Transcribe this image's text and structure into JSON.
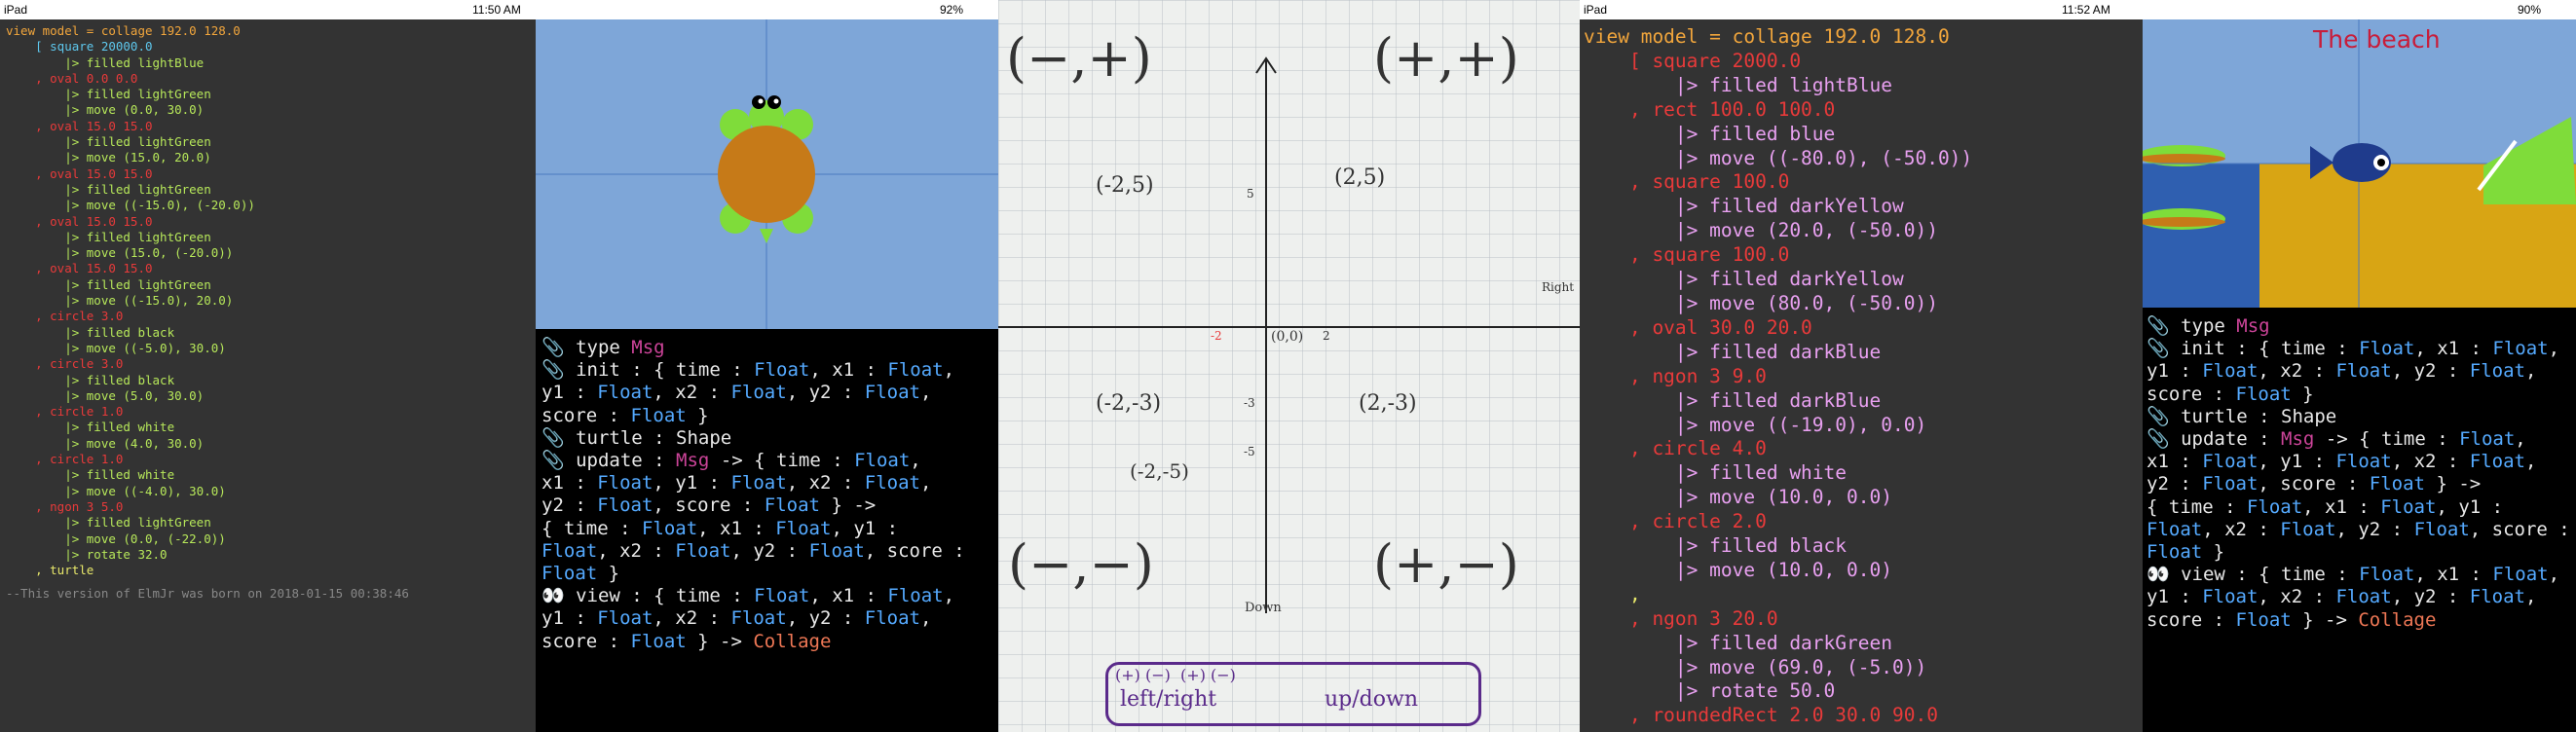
{
  "left_status": {
    "device": "iPad",
    "time": "11:50 AM",
    "battery": "92%"
  },
  "right_status": {
    "device": "iPad",
    "time": "11:52 AM",
    "battery": "90%"
  },
  "panel1": {
    "lines": [
      {
        "text": "view model = collage 192.0 128.0",
        "cls": "t-def"
      },
      {
        "text": "    [ square 20000.0",
        "cls": "t-num"
      },
      {
        "text": "        |> filled lightBlue",
        "cls": "t-fn"
      },
      {
        "text": "    , oval 0.0 0.0",
        "cls": "t-red"
      },
      {
        "text": "        |> filled lightGreen",
        "cls": "t-fn"
      },
      {
        "text": "        |> move (0.0, 30.0)",
        "cls": "t-fn"
      },
      {
        "text": "    , oval 15.0 15.0",
        "cls": "t-red"
      },
      {
        "text": "        |> filled lightGreen",
        "cls": "t-fn"
      },
      {
        "text": "        |> move (15.0, 20.0)",
        "cls": "t-fn"
      },
      {
        "text": "    , oval 15.0 15.0",
        "cls": "t-red"
      },
      {
        "text": "        |> filled lightGreen",
        "cls": "t-fn"
      },
      {
        "text": "        |> move ((-15.0), (-20.0))",
        "cls": "t-fn"
      },
      {
        "text": "    , oval 15.0 15.0",
        "cls": "t-red"
      },
      {
        "text": "        |> filled lightGreen",
        "cls": "t-fn"
      },
      {
        "text": "        |> move (15.0, (-20.0))",
        "cls": "t-fn"
      },
      {
        "text": "    , oval 15.0 15.0",
        "cls": "t-red"
      },
      {
        "text": "        |> filled lightGreen",
        "cls": "t-fn"
      },
      {
        "text": "        |> move ((-15.0), 20.0)",
        "cls": "t-fn"
      },
      {
        "text": "    , circle 3.0",
        "cls": "t-red"
      },
      {
        "text": "        |> filled black",
        "cls": "t-fn"
      },
      {
        "text": "        |> move ((-5.0), 30.0)",
        "cls": "t-fn"
      },
      {
        "text": "    , circle 3.0",
        "cls": "t-red"
      },
      {
        "text": "        |> filled black",
        "cls": "t-fn"
      },
      {
        "text": "        |> move (5.0, 30.0)",
        "cls": "t-fn"
      },
      {
        "text": "    , circle 1.0",
        "cls": "t-red"
      },
      {
        "text": "        |> filled white",
        "cls": "t-fn"
      },
      {
        "text": "        |> move (4.0, 30.0)",
        "cls": "t-fn"
      },
      {
        "text": "    , circle 1.0",
        "cls": "t-red"
      },
      {
        "text": "        |> filled white",
        "cls": "t-fn"
      },
      {
        "text": "        |> move ((-4.0), 30.0)",
        "cls": "t-fn"
      },
      {
        "text": "    , ngon 3 5.0",
        "cls": "t-red"
      },
      {
        "text": "        |> filled lightGreen",
        "cls": "t-fn"
      },
      {
        "text": "        |> move (0.0, (-22.0))",
        "cls": "t-fn"
      },
      {
        "text": "        |> rotate 32.0",
        "cls": "t-fn"
      },
      {
        "text": "    , turtle",
        "cls": "t-op"
      }
    ],
    "footer": "--This version of ElmJr was born on 2018-01-15 00:38:46"
  },
  "typepanel": {
    "lines": [
      "📎 type Msg",
      "📎 init : { time : Float, x1 : Float,",
      "y1 : Float, x2 : Float, y2 : Float,",
      "score : Float }",
      "📎 turtle : Shape",
      "📎 update : Msg -> { time : Float,",
      "x1 : Float, y1 : Float, x2 : Float,",
      "y2 : Float, score : Float } ->",
      "{ time : Float, x1 : Float, y1 :",
      "Float, x2 : Float, y2 : Float, score :",
      "Float }",
      "👀 view : { time : Float, x1 : Float,",
      "y1 : Float, x2 : Float, y2 : Float,",
      "score : Float } -> Collage"
    ]
  },
  "whiteboard": {
    "quad_labels": [
      "(−,+)",
      "(+,+)",
      "(−,−)",
      "(+,−)"
    ],
    "points": [
      "(-2,5)",
      "(2,5)",
      "(-2,-3)",
      "(2,-3)",
      "(-2,-5)",
      "(0,0)"
    ],
    "axis_labels": {
      "right": "Right",
      "down": "Down",
      "five": "5",
      "neg3": "-3",
      "neg5": "-5",
      "two": "2",
      "neg2": "-2"
    },
    "legend": "(+) (−)  (+) (−)",
    "legend_words": [
      "left/right",
      "up/down"
    ]
  },
  "panel4": {
    "lines": [
      {
        "text": "view model = collage 192.0 128.0",
        "cls": "t-def"
      },
      {
        "text": "    [ square 2000.0",
        "cls": "t-red"
      },
      {
        "text": "        |> filled lightBlue",
        "cls": "t-kw"
      },
      {
        "text": "    , rect 100.0 100.0",
        "cls": "t-red"
      },
      {
        "text": "        |> filled blue",
        "cls": "t-kw"
      },
      {
        "text": "        |> move ((-80.0), (-50.0))",
        "cls": "t-kw"
      },
      {
        "text": "    , square 100.0",
        "cls": "t-red"
      },
      {
        "text": "        |> filled darkYellow",
        "cls": "t-kw"
      },
      {
        "text": "        |> move (20.0, (-50.0))",
        "cls": "t-kw"
      },
      {
        "text": "    , square 100.0",
        "cls": "t-red"
      },
      {
        "text": "        |> filled darkYellow",
        "cls": "t-kw"
      },
      {
        "text": "        |> move (80.0, (-50.0))",
        "cls": "t-kw"
      },
      {
        "text": "    , oval 30.0 20.0",
        "cls": "t-red"
      },
      {
        "text": "        |> filled darkBlue",
        "cls": "t-kw"
      },
      {
        "text": "    , ngon 3 9.0",
        "cls": "t-red"
      },
      {
        "text": "        |> filled darkBlue",
        "cls": "t-kw"
      },
      {
        "text": "        |> move ((-19.0), 0.0)",
        "cls": "t-kw"
      },
      {
        "text": "    , circle 4.0",
        "cls": "t-red"
      },
      {
        "text": "        |> filled white",
        "cls": "t-kw"
      },
      {
        "text": "        |> move (10.0, 0.0)",
        "cls": "t-kw"
      },
      {
        "text": "    , circle 2.0",
        "cls": "t-red"
      },
      {
        "text": "        |> filled black",
        "cls": "t-kw"
      },
      {
        "text": "        |> move (10.0, 0.0)",
        "cls": "t-kw"
      },
      {
        "text": "    ,",
        "cls": "t-op"
      },
      {
        "text": "    , ngon 3 20.0",
        "cls": "t-red"
      },
      {
        "text": "        |> filled darkGreen",
        "cls": "t-kw"
      },
      {
        "text": "        |> move (69.0, (-5.0))",
        "cls": "t-kw"
      },
      {
        "text": "        |> rotate 50.0",
        "cls": "t-kw"
      },
      {
        "text": "    , roundedRect 2.0 30.0 90.0",
        "cls": "t-red"
      }
    ]
  },
  "beach": {
    "title": "The beach"
  },
  "colors": {
    "sky": "#7ea6d8",
    "turtle_shell": "#c67a18",
    "turtle_green": "#7fdc3a",
    "sea": "#2f5fb0",
    "sand": "#d8a514",
    "fish": "#1f3b8c"
  }
}
